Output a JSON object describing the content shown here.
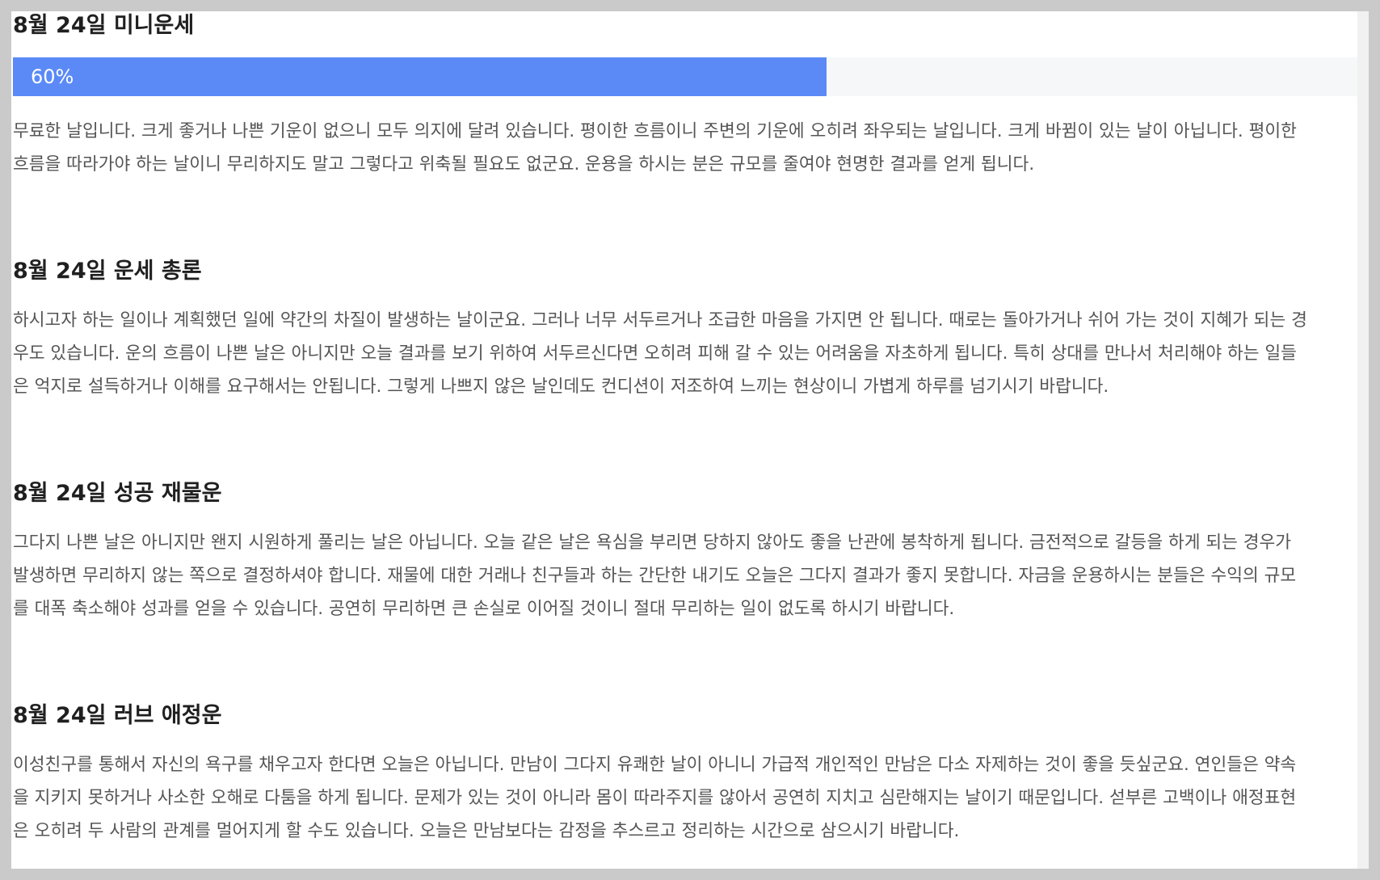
{
  "mini": {
    "title": "8월 24일 미니운세",
    "progress_label": "60%",
    "progress_value": 0.6,
    "accent_color": "#5b8af7",
    "lines": [
      "무료한 날입니다. 크게 좋거나 나쁜 기운이 없으니 모두 의지에 달려 있습니다. 평이한 흐름이니 주변의 기운에 오히려 좌우되는 날입니다. 크게 바뀜이 있는 날이 아닙니다. 평이한",
      "흐름을 따라가야 하는 날이니 무리하지도 말고 그렇다고 위축될 필요도 없군요. 운용을 하시는 분은 규모를 줄여야 현명한 결과를 얻게 됩니다."
    ]
  },
  "general": {
    "title": "8월 24일 운세 총론",
    "lines": [
      "하시고자 하는 일이나 계획했던 일에 약간의 차질이 발생하는 날이군요. 그러나 너무 서두르거나 조급한 마음을 가지면 안 됩니다. 때로는 돌아가거나 쉬어 가는 것이 지혜가 되는 경",
      "우도 있습니다. 운의 흐름이 나쁜 날은 아니지만 오늘 결과를 보기 위하여 서두르신다면 오히려 피해 갈 수 있는 어려움을 자초하게 됩니다. 특히 상대를 만나서 처리해야 하는 일들",
      "은 억지로 설득하거나 이해를 요구해서는 안됩니다. 그렇게 나쁘지 않은 날인데도 컨디션이 저조하여 느끼는 현상이니 가볍게 하루를 넘기시기 바랍니다."
    ]
  },
  "wealth": {
    "title": "8월 24일 성공 재물운",
    "lines": [
      "그다지 나쁜 날은 아니지만 왠지 시원하게 풀리는 날은 아닙니다. 오늘 같은 날은 욕심을 부리면 당하지 않아도 좋을 난관에 봉착하게 됩니다. 금전적으로 갈등을 하게 되는 경우가",
      "발생하면 무리하지 않는 쪽으로 결정하셔야 합니다. 재물에 대한 거래나 친구들과 하는 간단한 내기도 오늘은 그다지 결과가 좋지 못합니다. 자금을 운용하시는 분들은 수익의 규모",
      "를 대폭 축소해야 성과를 얻을 수 있습니다. 공연히 무리하면 큰 손실로 이어질 것이니 절대 무리하는 일이 없도록 하시기 바랍니다."
    ]
  },
  "love": {
    "title": "8월 24일 러브 애정운",
    "lines": [
      "이성친구를 통해서 자신의 욕구를 채우고자 한다면 오늘은 아닙니다. 만남이 그다지 유쾌한 날이 아니니 가급적 개인적인 만남은 다소 자제하는 것이 좋을 듯싶군요. 연인들은 약속",
      "을 지키지 못하거나 사소한 오해로 다툼을 하게 됩니다. 문제가 있는 것이 아니라 몸이 따라주지를 않아서 공연히 지치고 심란해지는 날이기 때문입니다. 섣부른 고백이나 애정표현",
      "은 오히려 두 사람의 관계를 멀어지게 할 수도 있습니다. 오늘은 만남보다는 감정을 추스르고 정리하는 시간으로 삼으시기 바랍니다."
    ]
  }
}
